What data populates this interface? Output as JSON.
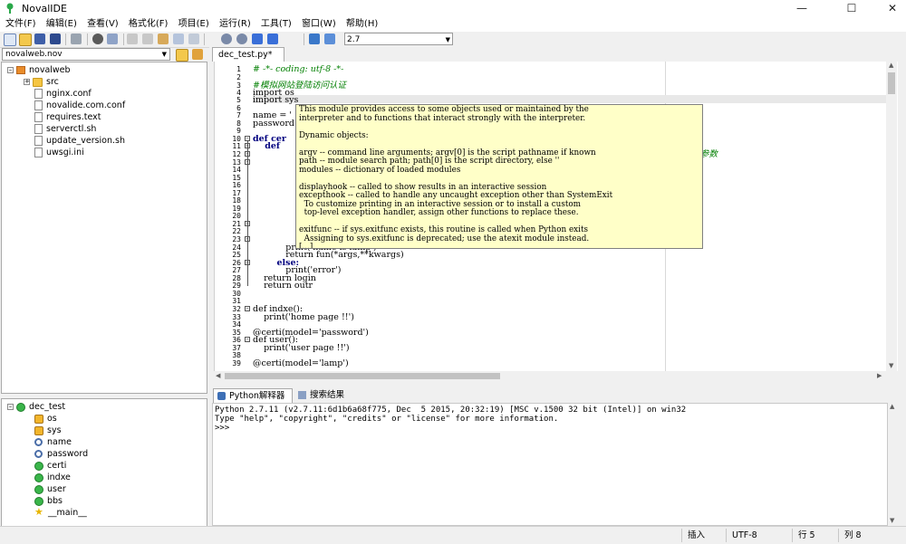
{
  "window": {
    "title": "NovalIDE"
  },
  "menu": [
    "文件(F)",
    "编辑(E)",
    "查看(V)",
    "格式化(F)",
    "项目(E)",
    "运行(R)",
    "工具(T)",
    "窗口(W)",
    "帮助(H)"
  ],
  "toolbar": {
    "interpreter": "2.7"
  },
  "project": {
    "selector": "novalweb.nov",
    "root": "novalweb",
    "items": [
      "src",
      "nginx.conf",
      "novalide.com.conf",
      "requires.text",
      "serverctl.sh",
      "update_version.sh",
      "uwsgi.ini"
    ]
  },
  "outline": {
    "root": "dec_test",
    "items": [
      "os",
      "sys",
      "name",
      "password",
      "certi",
      "indxe",
      "user",
      "bbs",
      "__main__"
    ]
  },
  "editor": {
    "tab": "dec_test.py*",
    "lines": [
      {
        "n": "1",
        "t": "# -*- coding: utf-8 -*-"
      },
      {
        "n": "2",
        "t": ""
      },
      {
        "n": "3",
        "t": "#模拟网站登陆访问认证"
      },
      {
        "n": "4",
        "t": "import os"
      },
      {
        "n": "5",
        "t": "import sys"
      },
      {
        "n": "6",
        "t": ""
      },
      {
        "n": "7",
        "t": "name = '"
      },
      {
        "n": "8",
        "t": "password"
      },
      {
        "n": "9",
        "t": ""
      },
      {
        "n": "10",
        "t": "def cer"
      },
      {
        "n": "11",
        "t": "    def"
      },
      {
        "n": "24",
        "t": "            print('name is lamp')"
      },
      {
        "n": "25",
        "t": "            return fun(*args,**kwargs)"
      },
      {
        "n": "26",
        "t": "        else:"
      },
      {
        "n": "27",
        "t": "            print('error')"
      },
      {
        "n": "28",
        "t": "    return login"
      },
      {
        "n": "29",
        "t": "    return outr"
      },
      {
        "n": "30",
        "t": ""
      },
      {
        "n": "31",
        "t": ""
      },
      {
        "n": "32",
        "t": "def indxe():"
      },
      {
        "n": "33",
        "t": "    print('home page !!')"
      },
      {
        "n": "34",
        "t": ""
      },
      {
        "n": "35",
        "t": "@certi(model='password')"
      },
      {
        "n": "36",
        "t": "def user():"
      },
      {
        "n": "37",
        "t": "    print('user page !!')"
      },
      {
        "n": "38",
        "t": ""
      },
      {
        "n": "39",
        "t": "@certi(model='lamp')"
      }
    ],
    "side_comment": "参数",
    "calltip": "This module provides access to some objects used or maintained by the\ninterpreter and to functions that interact strongly with the interpreter.\n\nDynamic objects:\n\nargv -- command line arguments; argv[0] is the script pathname if known\npath -- module search path; path[0] is the script directory, else ''\nmodules -- dictionary of loaded modules\n\ndisplayhook -- called to show results in an interactive session\nexcepthook -- called to handle any uncaught exception other than SystemExit\n  To customize printing in an interactive session or to install a custom\n  top-level exception handler, assign other functions to replace these.\n\nexitfunc -- if sys.exitfunc exists, this routine is called when Python exits\n  Assigning to sys.exitfunc is deprecated; use the atexit module instead.\n[...]"
  },
  "bottom": {
    "tabs": [
      "Python解释器",
      "搜索结果"
    ],
    "console": [
      "Python 2.7.11 (v2.7.11:6d1b6a68f775, Dec  5 2015, 20:32:19) [MSC v.1500 32 bit (Intel)] on win32",
      "Type \"help\", \"copyright\", \"credits\" or \"license\" for more information.",
      ">>> "
    ]
  },
  "status": {
    "mode": "插入",
    "encoding": "UTF-8",
    "row": "行 5",
    "col": "列 8"
  }
}
